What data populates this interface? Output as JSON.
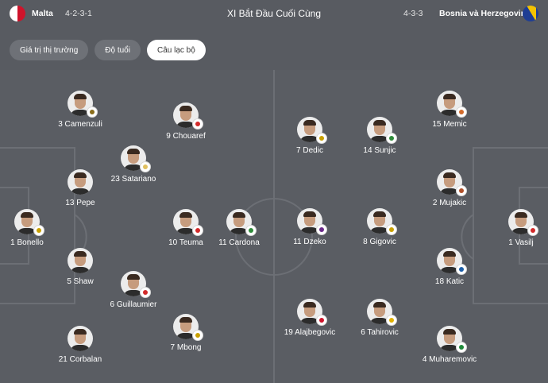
{
  "header": {
    "home_team": "Malta",
    "home_formation": "4-2-3-1",
    "title": "XI Bắt Đầu Cuối Cùng",
    "away_formation": "4-3-3",
    "away_team": "Bosnia và Herzegovina"
  },
  "tabs": [
    {
      "label": "Giá trị thị trường",
      "active": false
    },
    {
      "label": "Độ tuổi",
      "active": false
    },
    {
      "label": "Câu lạc bộ",
      "active": true
    }
  ],
  "home_players": [
    {
      "label": "1 Bonello",
      "badge_color": "#c8a000"
    },
    {
      "label": "3 Camenzuli",
      "badge_color": "#8a6d1a"
    },
    {
      "label": "13 Pepe",
      "badge_color": "#cf142b"
    },
    {
      "label": "5 Shaw",
      "badge_color": "#cf142b"
    },
    {
      "label": "21 Corbalan",
      "badge_color": "#cf142b"
    },
    {
      "label": "23 Satariano",
      "badge_color": "#e0c060"
    },
    {
      "label": "6 Guillaumier",
      "badge_color": "#d22a2a"
    },
    {
      "label": "9 Chouaref",
      "badge_color": "#d22a2a"
    },
    {
      "label": "10 Teuma",
      "badge_color": "#d22a2a"
    },
    {
      "label": "7 Mbong",
      "badge_color": "#c8a000"
    },
    {
      "label": "11 Cardona",
      "badge_color": "#2e8b3a"
    }
  ],
  "away_players": [
    {
      "label": "1 Vasilj",
      "badge_color": "#d22a2a"
    },
    {
      "label": "15 Memic",
      "badge_color": "#d26a2a"
    },
    {
      "label": "2 Mujakic",
      "badge_color": "#b0502a"
    },
    {
      "label": "18 Katic",
      "badge_color": "#1e5fa8"
    },
    {
      "label": "4 Muharemovic",
      "badge_color": "#1f8a3a"
    },
    {
      "label": "7 Dedic",
      "badge_color": "#c8a000"
    },
    {
      "label": "14 Sunjic",
      "badge_color": "#2e8b3a"
    },
    {
      "label": "8 Gigovic",
      "badge_color": "#c8a000"
    },
    {
      "label": "11 Dzeko",
      "badge_color": "#6a2a8a"
    },
    {
      "label": "19 Alajbegovic",
      "badge_color": "#cf142b"
    },
    {
      "label": "6 Tahirovic",
      "badge_color": "#e0b000"
    }
  ]
}
